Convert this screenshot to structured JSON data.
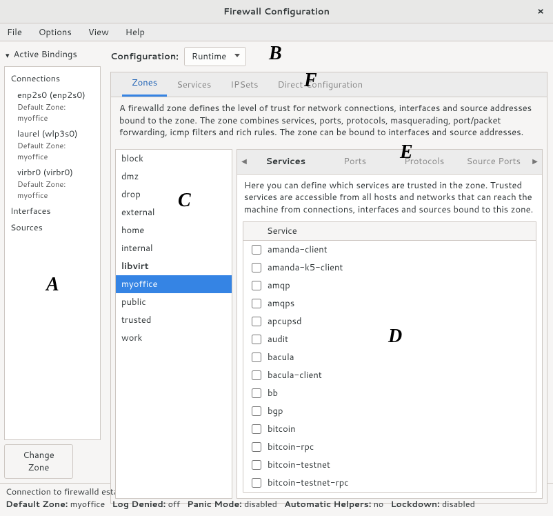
{
  "title": "Firewall Configuration",
  "menubar": [
    "File",
    "Options",
    "View",
    "Help"
  ],
  "sidebar": {
    "header": "Active Bindings",
    "connections_label": "Connections",
    "interfaces_label": "Interfaces",
    "sources_label": "Sources",
    "connections": [
      {
        "name": "enp2s0 (enp2s0)",
        "sub": "Default Zone: myoffice"
      },
      {
        "name": "laurel (wlp3s0)",
        "sub": "Default Zone: myoffice"
      },
      {
        "name": "virbr0 (virbr0)",
        "sub": "Default Zone: myoffice"
      }
    ],
    "change_zone_label": "Change Zone"
  },
  "config": {
    "label": "Configuration:",
    "value": "Runtime"
  },
  "tabs": {
    "items": [
      "Zones",
      "Services",
      "IPSets",
      "Direct Configuration"
    ],
    "active": 0
  },
  "zones_desc": "A firewalld zone defines the level of trust for network connections, interfaces and source addresses bound to the zone. The zone combines services, ports, protocols, masquerading, port/packet forwarding, icmp filters and rich rules. The zone can be bound to interfaces and source addresses.",
  "zone_list": [
    "block",
    "dmz",
    "drop",
    "external",
    "home",
    "internal",
    "libvirt",
    "myoffice",
    "public",
    "trusted",
    "work"
  ],
  "zone_selected": "myoffice",
  "zone_bold": "libvirt",
  "subtabs": [
    "Services",
    "Ports",
    "Protocols",
    "Source Ports"
  ],
  "subtab_active": 0,
  "services_desc": "Here you can define which services are trusted in the zone. Trusted services are accessible from all hosts and networks that can reach the machine from connections, interfaces and sources bound to this zone.",
  "service_header": "Service",
  "services": [
    "amanda-client",
    "amanda-k5-client",
    "amqp",
    "amqps",
    "apcupsd",
    "audit",
    "bacula",
    "bacula-client",
    "bb",
    "bgp",
    "bitcoin",
    "bitcoin-rpc",
    "bitcoin-testnet",
    "bitcoin-testnet-rpc"
  ],
  "status_line1": "Connection to firewalld established.",
  "status_parts": {
    "default_zone_l": "Default Zone:",
    "default_zone_v": "myoffice",
    "log_denied_l": "Log Denied:",
    "log_denied_v": "off",
    "panic_l": "Panic Mode:",
    "panic_v": "disabled",
    "autohelp_l": "Automatic Helpers:",
    "autohelp_v": "no",
    "lockdown_l": "Lockdown:",
    "lockdown_v": "disabled"
  },
  "annotations": {
    "A": "A",
    "B": "B",
    "C": "C",
    "D": "D",
    "E": "E",
    "F": "F"
  }
}
